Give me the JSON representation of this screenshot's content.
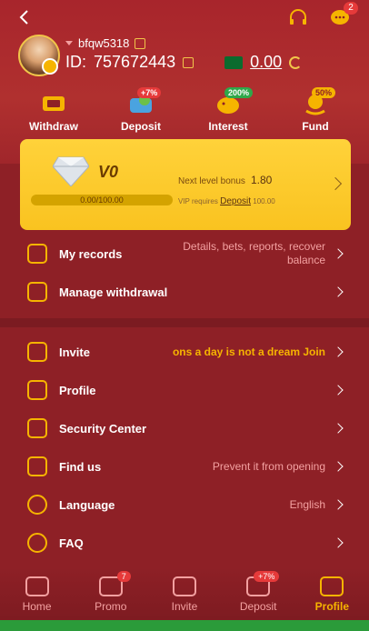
{
  "header": {
    "username": "bfqw5318",
    "id_label": "ID:",
    "id_value": "757672443",
    "balance": "0.00",
    "message_badge": "2"
  },
  "actions": [
    {
      "label": "Withdraw",
      "icon": "withdraw-icon",
      "pill": ""
    },
    {
      "label": "Deposit",
      "icon": "deposit-icon",
      "pill": "+7%"
    },
    {
      "label": "Interest",
      "icon": "interest-icon",
      "pill": "200%"
    },
    {
      "label": "Fund",
      "icon": "fund-icon",
      "pill": "50%"
    }
  ],
  "vip": {
    "level": "V0",
    "progress_text": "0.00/100.00",
    "progress": 0.0,
    "next_bonus_label": "Next level bonus",
    "next_bonus_value": "1.80",
    "requires_label": "VIP requires",
    "requires_action": "Deposit",
    "requires_value": "100.00"
  },
  "menu_primary": [
    {
      "label": "My records",
      "value": "Details, bets, reports, recover balance",
      "icon": "records-icon"
    },
    {
      "label": "Manage withdrawal",
      "value": "",
      "icon": "withdrawal-manage-icon"
    }
  ],
  "menu_secondary": [
    {
      "label": "Invite",
      "value": "ons a day is not a dream  Join",
      "icon": "invite-icon",
      "highlight": true
    },
    {
      "label": "Profile",
      "value": "",
      "icon": "profile-icon",
      "highlight": false
    },
    {
      "label": "Security Center",
      "value": "",
      "icon": "shield-icon",
      "highlight": false
    },
    {
      "label": "Find us",
      "value": "Prevent it from opening",
      "icon": "find-us-icon",
      "highlight": false
    },
    {
      "label": "Language",
      "value": "English",
      "icon": "globe-icon",
      "highlight": false
    },
    {
      "label": "FAQ",
      "value": "",
      "icon": "faq-icon",
      "highlight": false
    }
  ],
  "tabs": [
    {
      "label": "Home",
      "badge": ""
    },
    {
      "label": "Promo",
      "badge": "7"
    },
    {
      "label": "Invite",
      "badge": ""
    },
    {
      "label": "Deposit",
      "badge": "+7%"
    },
    {
      "label": "Profile",
      "badge": ""
    }
  ],
  "colors": {
    "background": "#8e2026",
    "accent": "#f6b400",
    "vip_card": "#ffd23a",
    "muted_text": "#f3a0a0"
  }
}
